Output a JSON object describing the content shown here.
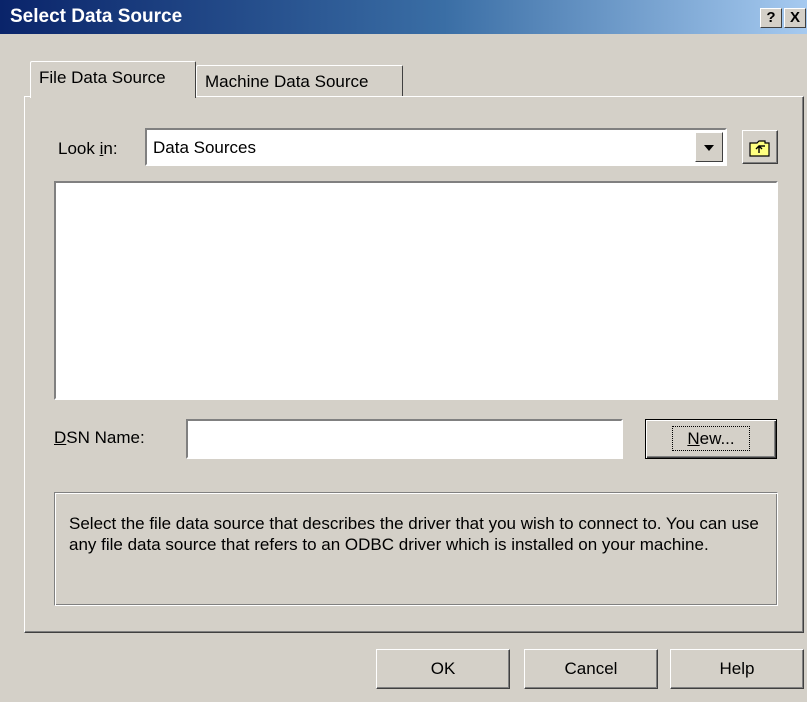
{
  "window": {
    "title": "Select Data Source",
    "help_button": "?",
    "close_button": "X"
  },
  "tabs": [
    {
      "label": "File Data Source",
      "active": true
    },
    {
      "label": "Machine Data Source",
      "active": false
    }
  ],
  "look_in": {
    "label_pre": "Look ",
    "label_accel": "i",
    "label_post": "n:",
    "value": "Data Sources"
  },
  "file_list": {
    "items": []
  },
  "dsn": {
    "label_accel": "D",
    "label_rest": "SN Name:",
    "value": "",
    "new_button_accel": "N",
    "new_button_rest": "ew..."
  },
  "description": "Select the file data source that describes the driver that you wish to connect to. You can use any file data source that refers to an ODBC driver which is installed on your machine.",
  "buttons": {
    "ok": "OK",
    "cancel": "Cancel",
    "help": "Help"
  },
  "colors": {
    "titlebar_start": "#0a246a",
    "titlebar_end": "#a6caf0",
    "face": "#d4d0c8",
    "folder_icon": "#ffff80"
  }
}
